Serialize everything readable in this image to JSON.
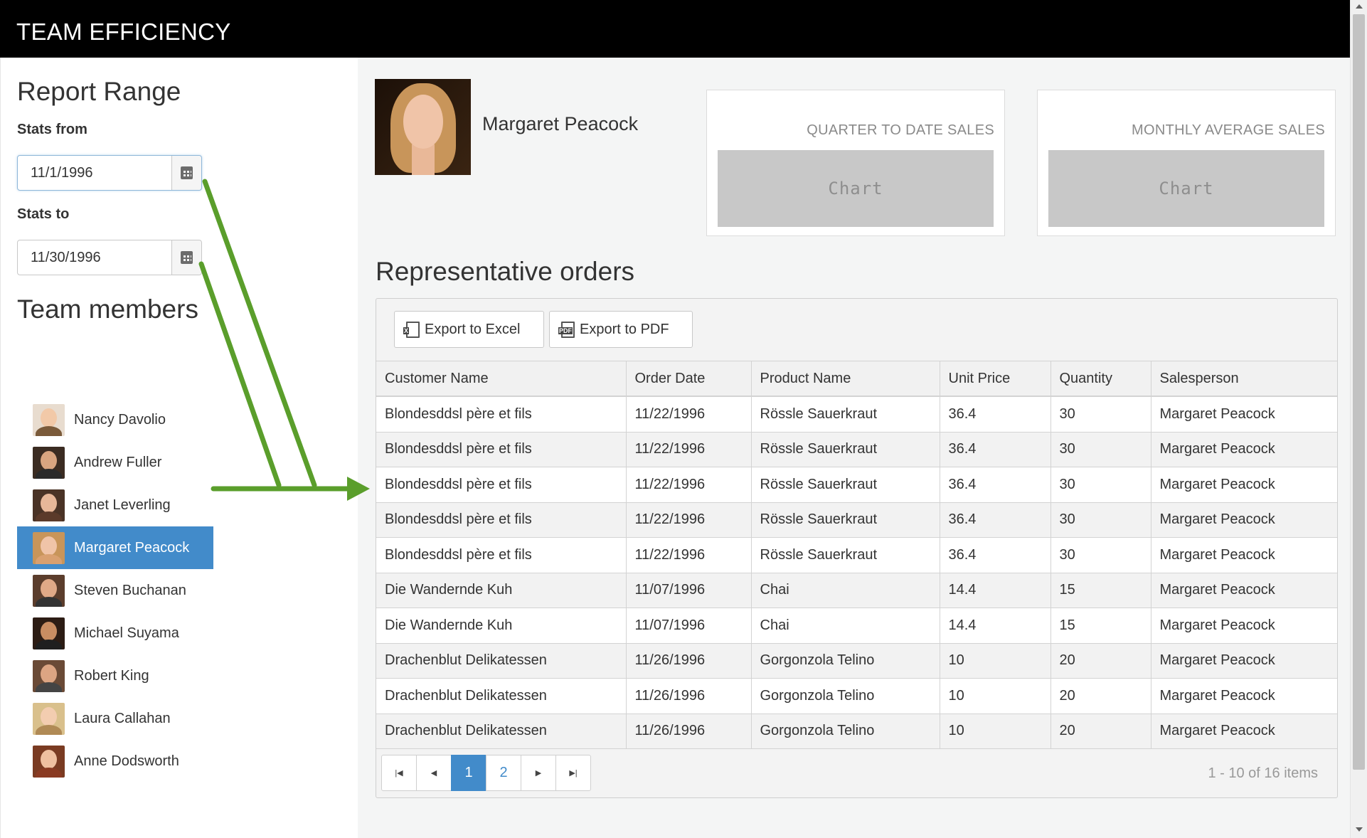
{
  "header": {
    "title": "TEAM EFFICIENCY"
  },
  "sidebar": {
    "report_range_title": "Report Range",
    "stats_from_label": "Stats from",
    "stats_from_value": "11/1/1996",
    "stats_to_label": "Stats to",
    "stats_to_value": "11/30/1996",
    "team_members_title": "Team members",
    "members": [
      {
        "name": "Nancy Davolio"
      },
      {
        "name": "Andrew Fuller"
      },
      {
        "name": "Janet Leverling"
      },
      {
        "name": "Margaret Peacock"
      },
      {
        "name": "Steven Buchanan"
      },
      {
        "name": "Michael Suyama"
      },
      {
        "name": "Robert King"
      },
      {
        "name": "Laura Callahan"
      },
      {
        "name": "Anne Dodsworth"
      }
    ]
  },
  "profile": {
    "name": "Margaret Peacock"
  },
  "kpis": {
    "quarter": {
      "title": "QUARTER TO DATE SALES",
      "chart_label": "Chart"
    },
    "monthly": {
      "title": "MONTHLY AVERAGE SALES",
      "chart_label": "Chart"
    }
  },
  "orders": {
    "title": "Representative orders",
    "export_excel": "Export to Excel",
    "export_pdf": "Export to PDF",
    "columns": [
      "Customer Name",
      "Order Date",
      "Product Name",
      "Unit Price",
      "Quantity",
      "Salesperson"
    ],
    "rows": [
      [
        "Blondesddsl père et fils",
        "11/22/1996",
        "Rössle Sauerkraut",
        "36.4",
        "30",
        "Margaret Peacock"
      ],
      [
        "Blondesddsl père et fils",
        "11/22/1996",
        "Rössle Sauerkraut",
        "36.4",
        "30",
        "Margaret Peacock"
      ],
      [
        "Blondesddsl père et fils",
        "11/22/1996",
        "Rössle Sauerkraut",
        "36.4",
        "30",
        "Margaret Peacock"
      ],
      [
        "Blondesddsl père et fils",
        "11/22/1996",
        "Rössle Sauerkraut",
        "36.4",
        "30",
        "Margaret Peacock"
      ],
      [
        "Blondesddsl père et fils",
        "11/22/1996",
        "Rössle Sauerkraut",
        "36.4",
        "30",
        "Margaret Peacock"
      ],
      [
        "Die Wandernde Kuh",
        "11/07/1996",
        "Chai",
        "14.4",
        "15",
        "Margaret Peacock"
      ],
      [
        "Die Wandernde Kuh",
        "11/07/1996",
        "Chai",
        "14.4",
        "15",
        "Margaret Peacock"
      ],
      [
        "Drachenblut Delikatessen",
        "11/26/1996",
        "Gorgonzola Telino",
        "10",
        "20",
        "Margaret Peacock"
      ],
      [
        "Drachenblut Delikatessen",
        "11/26/1996",
        "Gorgonzola Telino",
        "10",
        "20",
        "Margaret Peacock"
      ],
      [
        "Drachenblut Delikatessen",
        "11/26/1996",
        "Gorgonzola Telino",
        "10",
        "20",
        "Margaret Peacock"
      ]
    ],
    "pager": {
      "pages": [
        "1",
        "2"
      ],
      "current": "1",
      "info": "1 - 10 of 16 items"
    }
  },
  "colors": {
    "header_bg": "#000000",
    "selected_bg": "#428bca",
    "annotation_arrow": "#5a9e2b",
    "chart_placeholder": "#c8c8c8"
  },
  "icons": [
    "calendar-icon",
    "excel-file-icon",
    "pdf-file-icon",
    "first-page-icon",
    "prev-page-icon",
    "next-page-icon",
    "last-page-icon"
  ]
}
